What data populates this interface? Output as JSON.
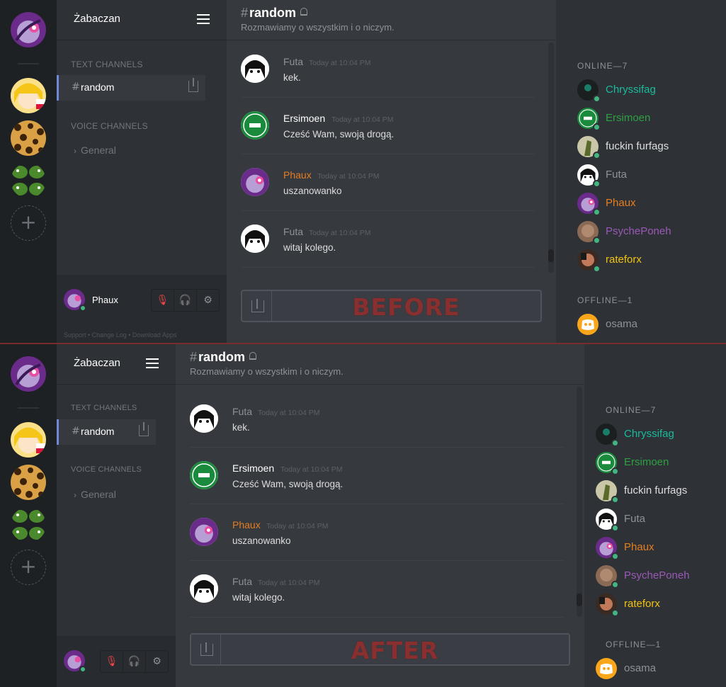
{
  "server_name": "Żabaczan",
  "channel": {
    "hash": "#",
    "name": "random",
    "topic": "Rozmawiamy o wszystkim i o niczym."
  },
  "sidebar": {
    "text_channels_label": "TEXT CHANNELS",
    "voice_channels_label": "VOICE CHANNELS",
    "voice_channel": "General",
    "chevron": "›"
  },
  "user": {
    "name": "Phaux",
    "footer_links": "Support  •  Change Log  •  Download Apps"
  },
  "messages": [
    {
      "author": "Futa",
      "color": "#8e9297",
      "time": "Today at 10:04 PM",
      "text": "kek.",
      "avatar": "futa"
    },
    {
      "author": "Ersimoen",
      "color": "#ffffff",
      "time": "Today at 10:04 PM",
      "text": "Cześć Wam, swoją drogą.",
      "avatar": "ersimoen"
    },
    {
      "author": "Phaux",
      "color": "#e67e22",
      "time": "Today at 10:04 PM",
      "text": "uszanowanko",
      "avatar": "phaux"
    },
    {
      "author": "Futa",
      "color": "#8e9297",
      "time": "Today at 10:04 PM",
      "text": "witaj kolego.",
      "avatar": "futa"
    }
  ],
  "members": {
    "online_label": "ONLINE—7",
    "offline_label": "OFFLINE—1",
    "online": [
      {
        "name": "Chryssifag",
        "color": "#1abc9c"
      },
      {
        "name": "Ersimoen",
        "color": "#2ea043"
      },
      {
        "name": "fuckin furfags",
        "color": "#dcddde"
      },
      {
        "name": "Futa",
        "color": "#8e9297"
      },
      {
        "name": "Phaux",
        "color": "#e67e22"
      },
      {
        "name": "PsychePoneh",
        "color": "#9b59b6"
      },
      {
        "name": "rateforx",
        "color": "#f1c40f"
      }
    ],
    "offline": [
      {
        "name": "osama",
        "color": "#8e9297"
      }
    ]
  },
  "labels": {
    "before": "BEFORE",
    "after": "AFTER"
  },
  "icons": {
    "menu": "hamburger-menu-icon",
    "invite": "invite-icon",
    "bell": "notification-bell-icon",
    "mute": "mic-muted-icon",
    "deafen": "headphones-icon",
    "settings": "gear-icon",
    "upload": "upload-icon",
    "add_server": "add-server-icon"
  }
}
